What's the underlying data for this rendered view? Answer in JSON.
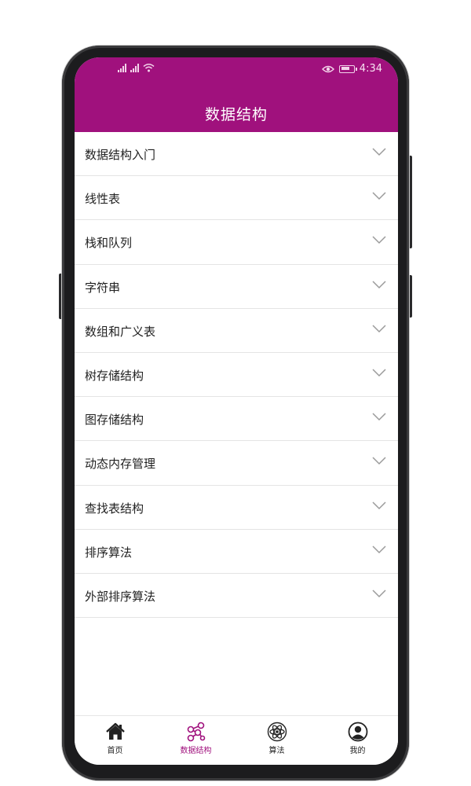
{
  "status_bar": {
    "time": "4:34"
  },
  "header": {
    "title": "数据结构"
  },
  "chapters": [
    {
      "label": "数据结构入门"
    },
    {
      "label": "线性表"
    },
    {
      "label": "栈和队列"
    },
    {
      "label": "字符串"
    },
    {
      "label": "数组和广义表"
    },
    {
      "label": "树存储结构"
    },
    {
      "label": "图存储结构"
    },
    {
      "label": "动态内存管理"
    },
    {
      "label": "查找表结构"
    },
    {
      "label": "排序算法"
    },
    {
      "label": "外部排序算法"
    }
  ],
  "bottom_nav": {
    "items": [
      {
        "label": "首页",
        "icon": "home-icon"
      },
      {
        "label": "数据结构",
        "icon": "data-structure-icon",
        "active": true
      },
      {
        "label": "算法",
        "icon": "atom-icon"
      },
      {
        "label": "我的",
        "icon": "user-icon"
      }
    ]
  },
  "colors": {
    "accent": "#a0117d",
    "divider": "#e4e4e4",
    "text": "#222222"
  }
}
